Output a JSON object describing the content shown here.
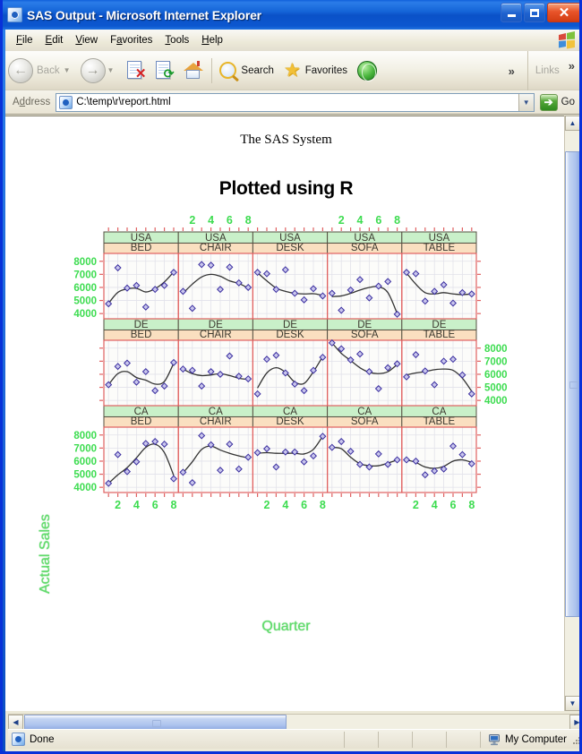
{
  "window": {
    "title": "SAS Output - Microsoft Internet Explorer",
    "app_icon": "ie-document-icon",
    "minimize_label": "_",
    "maximize_label": "□",
    "close_label": "✕"
  },
  "menu": {
    "items": [
      "File",
      "Edit",
      "View",
      "Favorites",
      "Tools",
      "Help"
    ]
  },
  "toolbar": {
    "back_label": "Back",
    "forward_label": "",
    "stop_label": "Stop",
    "refresh_label": "Refresh",
    "home_label": "Home",
    "search_label": "Search",
    "favorites_label": "Favorites",
    "media_label": "Media",
    "overflow_label": "»",
    "links_label": "Links",
    "links_overflow_label": "»"
  },
  "address": {
    "label": "Address",
    "value": "C:\\temp\\r\\report.html",
    "placeholder": "",
    "dropdown_glyph": "▼",
    "go_label": "Go",
    "go_glyph": "➔"
  },
  "status": {
    "text": "Done",
    "zone": "My Computer"
  },
  "page": {
    "sas_title": "The SAS System",
    "plot_title": "Plotted using R"
  },
  "chart_data": {
    "type": "scatter",
    "title": "Plotted using R",
    "xlabel": "Quarter",
    "ylabel": "Actual Sales",
    "grid": true,
    "legend_position": "none",
    "xlim": [
      0.5,
      8.5
    ],
    "ylim": [
      3600,
      8600
    ],
    "xticks": [
      1,
      2,
      3,
      4,
      5,
      6,
      7,
      8
    ],
    "xticklabels": [
      "",
      "2",
      "",
      "4",
      "",
      "6",
      "",
      "8"
    ],
    "xtick_visible_labels": [
      "2",
      "4",
      "6",
      "8"
    ],
    "yticks": [
      4000,
      5000,
      6000,
      7000,
      8000
    ],
    "yticklabels": [
      "4000",
      "5000",
      "6000",
      "7000",
      "8000"
    ],
    "strip_colors": {
      "country": "#c9f0c9",
      "product": "#fadfc0"
    },
    "point_color": "#3b2fa0",
    "line_color": "#333333",
    "axis_color": "#e06060",
    "label_color": "#3ddc50",
    "row_labels": [
      "USA",
      "DE",
      "CA"
    ],
    "col_labels": [
      "BED",
      "CHAIR",
      "DESK",
      "SOFA",
      "TABLE"
    ],
    "panels": [
      {
        "row": "USA",
        "col": "BED",
        "x": [
          1,
          2,
          3,
          4,
          5,
          6,
          7,
          8
        ],
        "y": [
          4750,
          7500,
          5950,
          6150,
          4500,
          5850,
          6150,
          7150
        ],
        "smooth": [
          4780,
          5620,
          5880,
          5930,
          5650,
          5900,
          6420,
          7180
        ]
      },
      {
        "row": "USA",
        "col": "CHAIR",
        "x": [
          1,
          2,
          3,
          4,
          5,
          6,
          7,
          8
        ],
        "y": [
          5700,
          4400,
          7750,
          7700,
          5850,
          7550,
          6350,
          6000
        ],
        "smooth": [
          5550,
          6250,
          6800,
          7000,
          6850,
          6500,
          6300,
          5950
        ]
      },
      {
        "row": "USA",
        "col": "DESK",
        "x": [
          1,
          2,
          3,
          4,
          5,
          6,
          7,
          8
        ],
        "y": [
          7150,
          7050,
          5850,
          7350,
          5550,
          5050,
          5900,
          5350
        ],
        "smooth": [
          7120,
          6500,
          5950,
          5700,
          5550,
          5500,
          5520,
          5400
        ]
      },
      {
        "row": "USA",
        "col": "SOFA",
        "x": [
          1,
          2,
          3,
          4,
          5,
          6,
          7,
          8
        ],
        "y": [
          5550,
          4250,
          5800,
          6600,
          5200,
          6100,
          6450,
          3950
        ],
        "smooth": [
          5300,
          5350,
          5550,
          5800,
          6000,
          6050,
          5600,
          4000
        ]
      },
      {
        "row": "USA",
        "col": "TABLE",
        "x": [
          1,
          2,
          3,
          4,
          5,
          6,
          7,
          8
        ],
        "y": [
          7150,
          7050,
          4950,
          5700,
          6200,
          4800,
          5600,
          5500
        ],
        "smooth": [
          7100,
          6250,
          5600,
          5500,
          5600,
          5500,
          5450,
          5500
        ]
      },
      {
        "row": "DE",
        "col": "BED",
        "x": [
          1,
          2,
          3,
          4,
          5,
          6,
          7,
          8
        ],
        "y": [
          5200,
          6600,
          6850,
          5400,
          6200,
          4750,
          5100,
          6900
        ],
        "smooth": [
          5200,
          6050,
          6200,
          5750,
          5550,
          5250,
          5450,
          6850
        ]
      },
      {
        "row": "DE",
        "col": "CHAIR",
        "x": [
          1,
          2,
          3,
          4,
          5,
          6,
          7,
          8
        ],
        "y": [
          6400,
          6300,
          5100,
          6200,
          6000,
          7400,
          5850,
          5650
        ],
        "smooth": [
          6400,
          6050,
          5900,
          5950,
          6050,
          5900,
          5700,
          5600
        ]
      },
      {
        "row": "DE",
        "col": "DESK",
        "x": [
          1,
          2,
          3,
          4,
          5,
          6,
          7,
          8
        ],
        "y": [
          4500,
          7150,
          7450,
          6100,
          5250,
          4750,
          6300,
          7300
        ],
        "smooth": [
          4950,
          6100,
          6500,
          6150,
          5400,
          5300,
          6200,
          7350
        ]
      },
      {
        "row": "DE",
        "col": "SOFA",
        "x": [
          1,
          2,
          3,
          4,
          5,
          6,
          7,
          8
        ],
        "y": [
          8400,
          7950,
          7100,
          7550,
          6200,
          4900,
          6500,
          6800
        ],
        "smooth": [
          8400,
          7600,
          7050,
          6500,
          6150,
          6050,
          6200,
          6750
        ]
      },
      {
        "row": "DE",
        "col": "TABLE",
        "x": [
          1,
          2,
          3,
          4,
          5,
          6,
          7,
          8
        ],
        "y": [
          5800,
          7500,
          6250,
          5200,
          7000,
          7150,
          5950,
          4500
        ],
        "smooth": [
          5950,
          6100,
          6200,
          6350,
          6400,
          6300,
          5700,
          4700
        ]
      },
      {
        "row": "CA",
        "col": "BED",
        "x": [
          1,
          2,
          3,
          4,
          5,
          6,
          7,
          8
        ],
        "y": [
          4300,
          6500,
          5200,
          5950,
          7350,
          7500,
          7300,
          4650
        ],
        "smooth": [
          4300,
          4950,
          5500,
          6250,
          7050,
          7300,
          6650,
          4900
        ]
      },
      {
        "row": "CA",
        "col": "CHAIR",
        "x": [
          1,
          2,
          3,
          4,
          5,
          6,
          7,
          8
        ],
        "y": [
          5150,
          4350,
          7950,
          7250,
          5300,
          7300,
          5400,
          6300
        ],
        "smooth": [
          5100,
          5950,
          6900,
          7150,
          6850,
          6600,
          6400,
          6250
        ]
      },
      {
        "row": "CA",
        "col": "DESK",
        "x": [
          1,
          2,
          3,
          4,
          5,
          6,
          7,
          8
        ],
        "y": [
          6650,
          6950,
          5550,
          6700,
          6700,
          5950,
          6400,
          7900
        ],
        "smooth": [
          6600,
          6650,
          6600,
          6600,
          6600,
          6550,
          6900,
          7900
        ]
      },
      {
        "row": "CA",
        "col": "SOFA",
        "x": [
          1,
          2,
          3,
          4,
          5,
          6,
          7,
          8
        ],
        "y": [
          7050,
          7500,
          6750,
          5750,
          5550,
          6550,
          5750,
          6100
        ],
        "smooth": [
          7050,
          6950,
          6300,
          5800,
          5650,
          5650,
          5850,
          6100
        ]
      },
      {
        "row": "CA",
        "col": "TABLE",
        "x": [
          1,
          2,
          3,
          4,
          5,
          6,
          7,
          8
        ],
        "y": [
          6100,
          6000,
          4950,
          5250,
          5400,
          7150,
          6500,
          5800
        ],
        "smooth": [
          6100,
          5900,
          5550,
          5450,
          5600,
          6000,
          6100,
          5900
        ]
      }
    ]
  }
}
